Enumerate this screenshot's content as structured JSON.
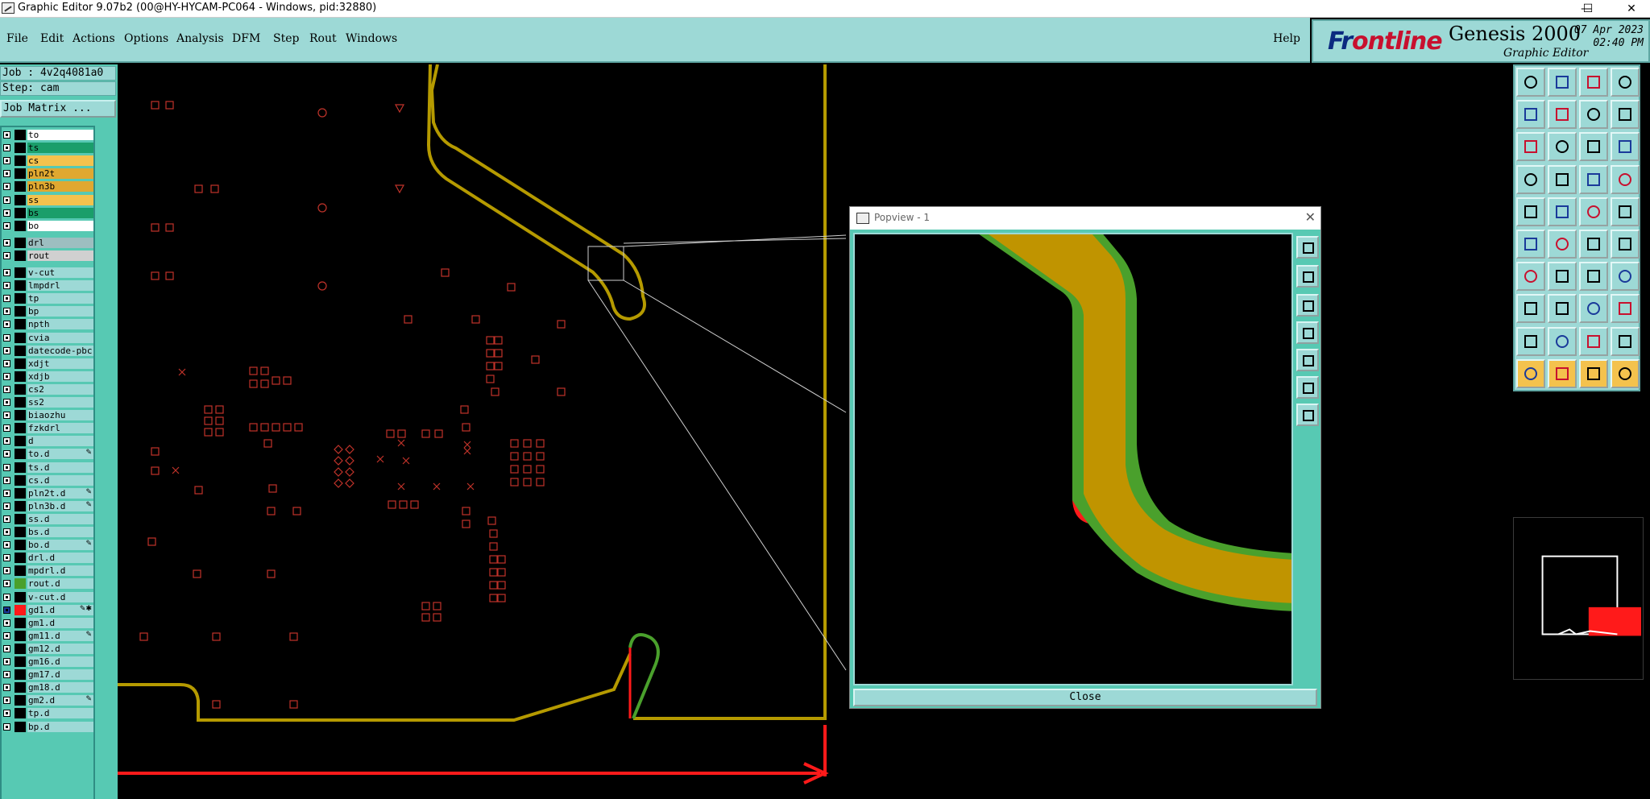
{
  "window": {
    "title": "Graphic Editor 9.07b2 (00@HY-HYCAM-PC064 - Windows, pid:32880)",
    "controls": {
      "minimize": "—",
      "maximize": "☐",
      "close": "✕"
    }
  },
  "menu": {
    "items": [
      "File",
      "Edit",
      "Actions",
      "Options",
      "Analysis",
      "DFM",
      "Step",
      "Rout",
      "Windows"
    ],
    "help": "Help"
  },
  "logo": {
    "brand_a": "Fr",
    "brand_b": "ontline",
    "product": "Genesis 2000",
    "subtitle": "Graphic Editor",
    "date": "07 Apr 2023",
    "time": "02:40 PM"
  },
  "job": {
    "job_label": "Job : 4v2q4081a0",
    "step_label": "Step: cam",
    "matrix_button": "Job Matrix ..."
  },
  "layers": [
    {
      "name": "to",
      "bg": "#ffffff",
      "sw": "#000000"
    },
    {
      "name": "ts",
      "bg": "#1a9e6a",
      "sw": "#000000"
    },
    {
      "name": "cs",
      "bg": "#f4c24d",
      "sw": "#000000"
    },
    {
      "name": "pln2t",
      "bg": "#e0a830",
      "sw": "#000000"
    },
    {
      "name": "pln3b",
      "bg": "#e0a830",
      "sw": "#000000"
    },
    {
      "name": "ss",
      "bg": "#f4c24d",
      "sw": "#000000"
    },
    {
      "name": "bs",
      "bg": "#1a9e6a",
      "sw": "#000000"
    },
    {
      "name": "bo",
      "bg": "#ffffff",
      "sw": "#000000"
    },
    {
      "name": "drl",
      "bg": "#9dbec0",
      "sw": "#000000",
      "gap": true
    },
    {
      "name": "rout",
      "bg": "#d0d0d0",
      "sw": "#000000"
    },
    {
      "name": "v-cut",
      "bg": "#9dd9d6",
      "sw": "#000000",
      "gap": true
    },
    {
      "name": "lmpdrl",
      "bg": "#9dd9d6",
      "sw": "#000000"
    },
    {
      "name": "tp",
      "bg": "#9dd9d6",
      "sw": "#000000"
    },
    {
      "name": "bp",
      "bg": "#9dd9d6",
      "sw": "#000000"
    },
    {
      "name": "npth",
      "bg": "#9dd9d6",
      "sw": "#000000"
    },
    {
      "name": "cvia",
      "bg": "#9dd9d6",
      "sw": "#000000"
    },
    {
      "name": "datecode-pbc",
      "bg": "#9dd9d6",
      "sw": "#000000"
    },
    {
      "name": "xdjt",
      "bg": "#9dd9d6",
      "sw": "#000000"
    },
    {
      "name": "xdjb",
      "bg": "#9dd9d6",
      "sw": "#000000"
    },
    {
      "name": "cs2",
      "bg": "#9dd9d6",
      "sw": "#000000"
    },
    {
      "name": "ss2",
      "bg": "#9dd9d6",
      "sw": "#000000"
    },
    {
      "name": "biaozhu",
      "bg": "#9dd9d6",
      "sw": "#000000"
    },
    {
      "name": "fzkdrl",
      "bg": "#9dd9d6",
      "sw": "#000000"
    },
    {
      "name": "d",
      "bg": "#9dd9d6",
      "sw": "#000000"
    },
    {
      "name": "to.d",
      "bg": "#9dd9d6",
      "sw": "#000000",
      "mark": "✎"
    },
    {
      "name": "ts.d",
      "bg": "#9dd9d6",
      "sw": "#000000"
    },
    {
      "name": "cs.d",
      "bg": "#9dd9d6",
      "sw": "#000000"
    },
    {
      "name": "pln2t.d",
      "bg": "#9dd9d6",
      "sw": "#000000",
      "mark": "✎"
    },
    {
      "name": "pln3b.d",
      "bg": "#9dd9d6",
      "sw": "#000000",
      "mark": "✎"
    },
    {
      "name": "ss.d",
      "bg": "#9dd9d6",
      "sw": "#000000"
    },
    {
      "name": "bs.d",
      "bg": "#9dd9d6",
      "sw": "#000000"
    },
    {
      "name": "bo.d",
      "bg": "#9dd9d6",
      "sw": "#000000",
      "mark": "✎"
    },
    {
      "name": "drl.d",
      "bg": "#9dd9d6",
      "sw": "#000000"
    },
    {
      "name": "mpdrl.d",
      "bg": "#9dd9d6",
      "sw": "#000000"
    },
    {
      "name": "rout.d",
      "bg": "#9dd9d6",
      "sw": "#4aa02c"
    },
    {
      "name": "v-cut.d",
      "bg": "#9dd9d6",
      "sw": "#000000"
    },
    {
      "name": "gd1.d",
      "bg": "#9dd9d6",
      "sw": "#ff1a1a",
      "mark": "✎✱",
      "active": true
    },
    {
      "name": "gm1.d",
      "bg": "#9dd9d6",
      "sw": "#000000"
    },
    {
      "name": "gm11.d",
      "bg": "#9dd9d6",
      "sw": "#000000",
      "mark": "✎"
    },
    {
      "name": "gm12.d",
      "bg": "#9dd9d6",
      "sw": "#000000"
    },
    {
      "name": "gm16.d",
      "bg": "#9dd9d6",
      "sw": "#000000"
    },
    {
      "name": "gm17.d",
      "bg": "#9dd9d6",
      "sw": "#000000"
    },
    {
      "name": "gm18.d",
      "bg": "#9dd9d6",
      "sw": "#000000"
    },
    {
      "name": "gm2.d",
      "bg": "#9dd9d6",
      "sw": "#000000",
      "mark": "✎"
    },
    {
      "name": "tp.d",
      "bg": "#9dd9d6",
      "sw": "#000000"
    },
    {
      "name": "bp.d",
      "bg": "#9dd9d6",
      "sw": "#000000"
    }
  ],
  "popview": {
    "title": "Popview - 1",
    "close_icon": "✕",
    "close_button": "Close"
  },
  "colors": {
    "board_outline": "#b59a00",
    "pad_red": "#c0332a",
    "rout_green": "#4aa02c",
    "highlight_red": "#ff1a1a",
    "trace_gold": "#c09400"
  }
}
